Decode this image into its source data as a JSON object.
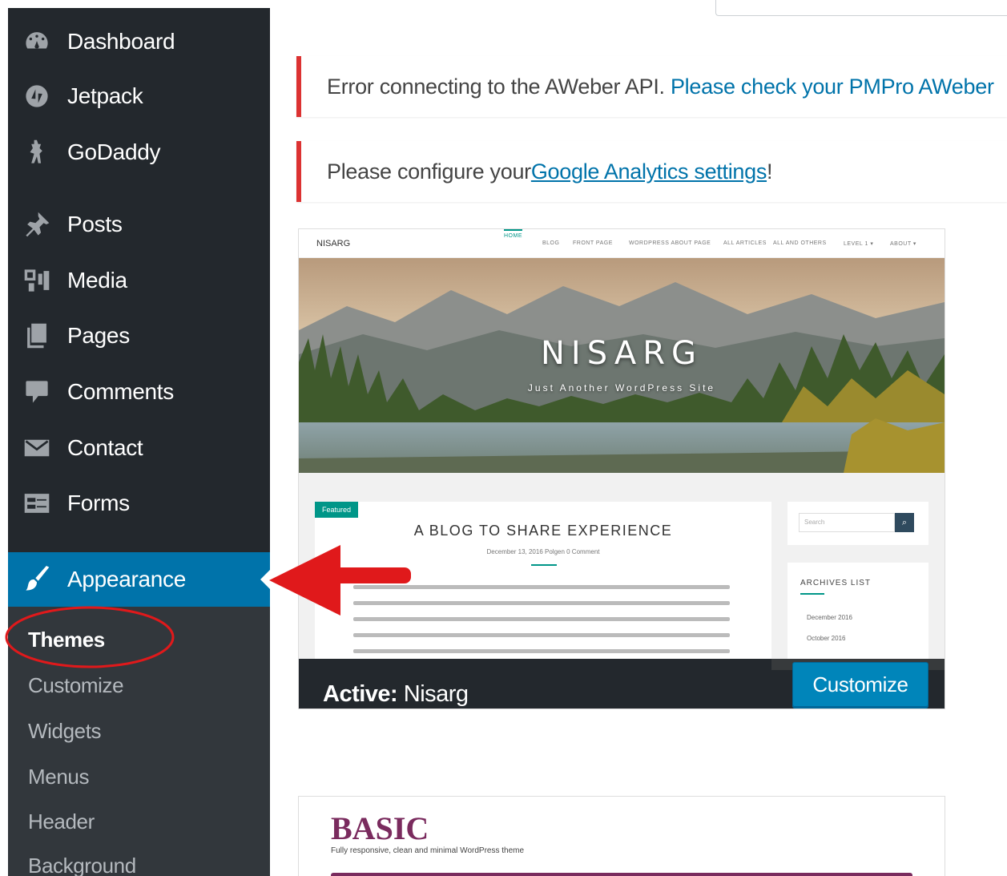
{
  "sidebar": {
    "items": [
      {
        "label": "Dashboard",
        "icon": "dashboard-icon"
      },
      {
        "label": "Jetpack",
        "icon": "jetpack-icon"
      },
      {
        "label": "GoDaddy",
        "icon": "godaddy-icon"
      },
      {
        "label": "Posts",
        "icon": "pin-icon"
      },
      {
        "label": "Media",
        "icon": "media-icon"
      },
      {
        "label": "Pages",
        "icon": "pages-icon"
      },
      {
        "label": "Comments",
        "icon": "comment-icon"
      },
      {
        "label": "Contact",
        "icon": "envelope-icon"
      },
      {
        "label": "Forms",
        "icon": "forms-icon"
      },
      {
        "label": "Appearance",
        "icon": "paintbrush-icon",
        "active": true
      }
    ],
    "submenu": [
      {
        "label": "Themes",
        "current": true
      },
      {
        "label": "Customize"
      },
      {
        "label": "Widgets"
      },
      {
        "label": "Menus"
      },
      {
        "label": "Header"
      },
      {
        "label": "Background"
      }
    ]
  },
  "notices": {
    "aweber": {
      "text": "Error connecting to the AWeber API. ",
      "link": "Please check your PMPro AWeber"
    },
    "analytics": {
      "prefix": "Please configure your ",
      "link": "Google Analytics settings",
      "suffix": "!"
    }
  },
  "active_theme": {
    "screenshot": {
      "logo": "NISARG",
      "nav": [
        "HOME",
        "BLOG",
        "FRONT PAGE",
        "WORDPRESS ABOUT PAGE",
        "ALL ARTICLES",
        "ALL AND OTHERS",
        "LEVEL 1 ▾",
        "ABOUT ▾"
      ],
      "hero_title": "NISARG",
      "hero_subtitle": "Just Another WordPress Site",
      "featured_badge": "Featured",
      "post_title": "A BLOG TO SHARE EXPERIENCE",
      "post_meta": "December 13, 2016  Polgen  0 Comment",
      "search_placeholder": "Search",
      "archives_title": "ARCHIVES LIST",
      "archive_items": [
        "December 2016",
        "October 2016"
      ]
    },
    "active_prefix": "Active:",
    "name": "Nisarg",
    "customize_label": "Customize"
  },
  "basic_theme": {
    "title": "BASIC",
    "subtitle": "Fully responsive, clean and minimal WordPress theme"
  },
  "colors": {
    "sidebar_bg": "#23282d",
    "submenu_bg": "#32373c",
    "accent": "#0073aa",
    "notice_error": "#dc3232",
    "annotation_red": "#e0191b"
  }
}
